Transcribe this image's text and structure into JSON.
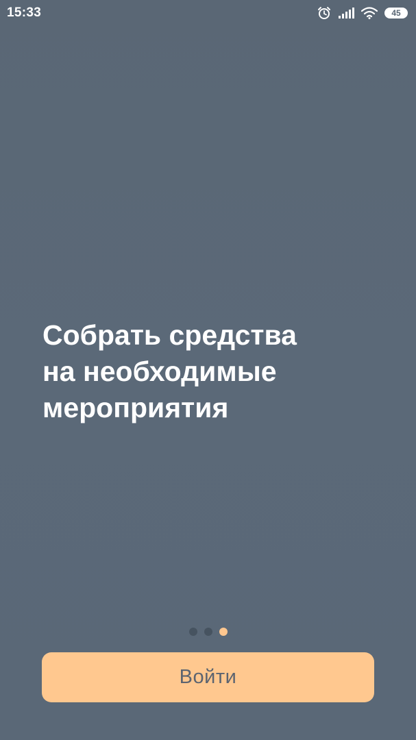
{
  "status_bar": {
    "time": "15:33",
    "icons": [
      "alarm-icon",
      "signal-icon",
      "wifi-icon",
      "battery-icon"
    ],
    "battery_level": "45"
  },
  "onboarding": {
    "headline_lines": [
      "Собрать средства",
      "на необходимые",
      "мероприятия"
    ],
    "pager": {
      "total": 3,
      "active_index": 2
    }
  },
  "login": {
    "label": "Войти"
  },
  "colors": {
    "background": "#5b6977",
    "accent": "#ffc88f",
    "dot_inactive": "#465360"
  }
}
